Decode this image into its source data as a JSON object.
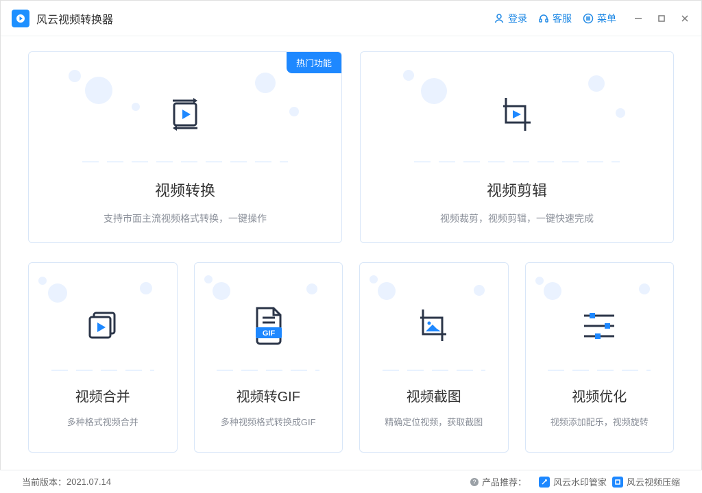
{
  "app": {
    "title": "风云视频转换器"
  },
  "titlebar": {
    "login": "登录",
    "support": "客服",
    "menu": "菜单"
  },
  "cards": {
    "hot_badge": "热门功能",
    "convert": {
      "title": "视频转换",
      "desc": "支持市面主流视频格式转换，一键操作"
    },
    "edit": {
      "title": "视频剪辑",
      "desc": "视频裁剪，视频剪辑，一键快速完成"
    },
    "merge": {
      "title": "视频合并",
      "desc": "多种格式视频合并"
    },
    "gif": {
      "title": "视频转GIF",
      "desc": "多种视频格式转换成GIF",
      "badge": "GIF"
    },
    "screenshot": {
      "title": "视频截图",
      "desc": "精确定位视频，获取截图"
    },
    "optimize": {
      "title": "视频优化",
      "desc": "视频添加配乐，视频旋转"
    }
  },
  "statusbar": {
    "version_label": "当前版本：",
    "version_value": "2021.07.14",
    "recommend_label": "产品推荐：",
    "rec1": "风云水印管家",
    "rec2": "风云视频压缩"
  }
}
